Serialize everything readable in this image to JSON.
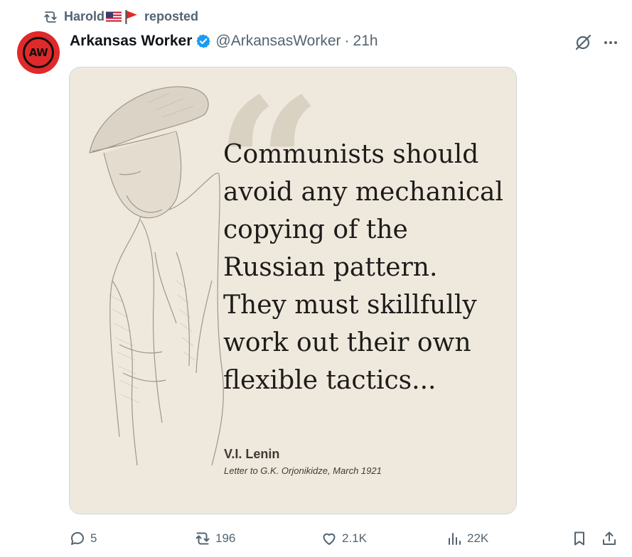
{
  "repost": {
    "user": "Harold",
    "suffix": "reposted"
  },
  "post": {
    "avatar_text": "AW",
    "display_name": "Arkansas Worker",
    "handle": "@ArkansasWorker",
    "separator": "·",
    "time": "21h"
  },
  "image": {
    "quote_lines": [
      "Communists should",
      "avoid any mechanical",
      "copying of the",
      "Russian pattern.",
      "They must skillfully",
      "work out their own",
      "flexible tactics..."
    ],
    "author": "V.I. Lenin",
    "source": "Letter to G.K. Orjonikidze, March 1921"
  },
  "actions": {
    "replies": "5",
    "reposts": "196",
    "likes": "2.1K",
    "views": "22K"
  },
  "colors": {
    "accent_blue": "#1d9bf0",
    "secondary_text": "#536471",
    "avatar_red": "#e0292a",
    "image_background": "#efe9dd"
  },
  "icons": [
    "repost-icon",
    "us-flag-icon",
    "red-flag-icon",
    "verified-badge-icon",
    "grok-icon",
    "more-icon",
    "reply-icon",
    "repost-icon",
    "like-icon",
    "views-icon",
    "bookmark-icon",
    "share-icon"
  ]
}
